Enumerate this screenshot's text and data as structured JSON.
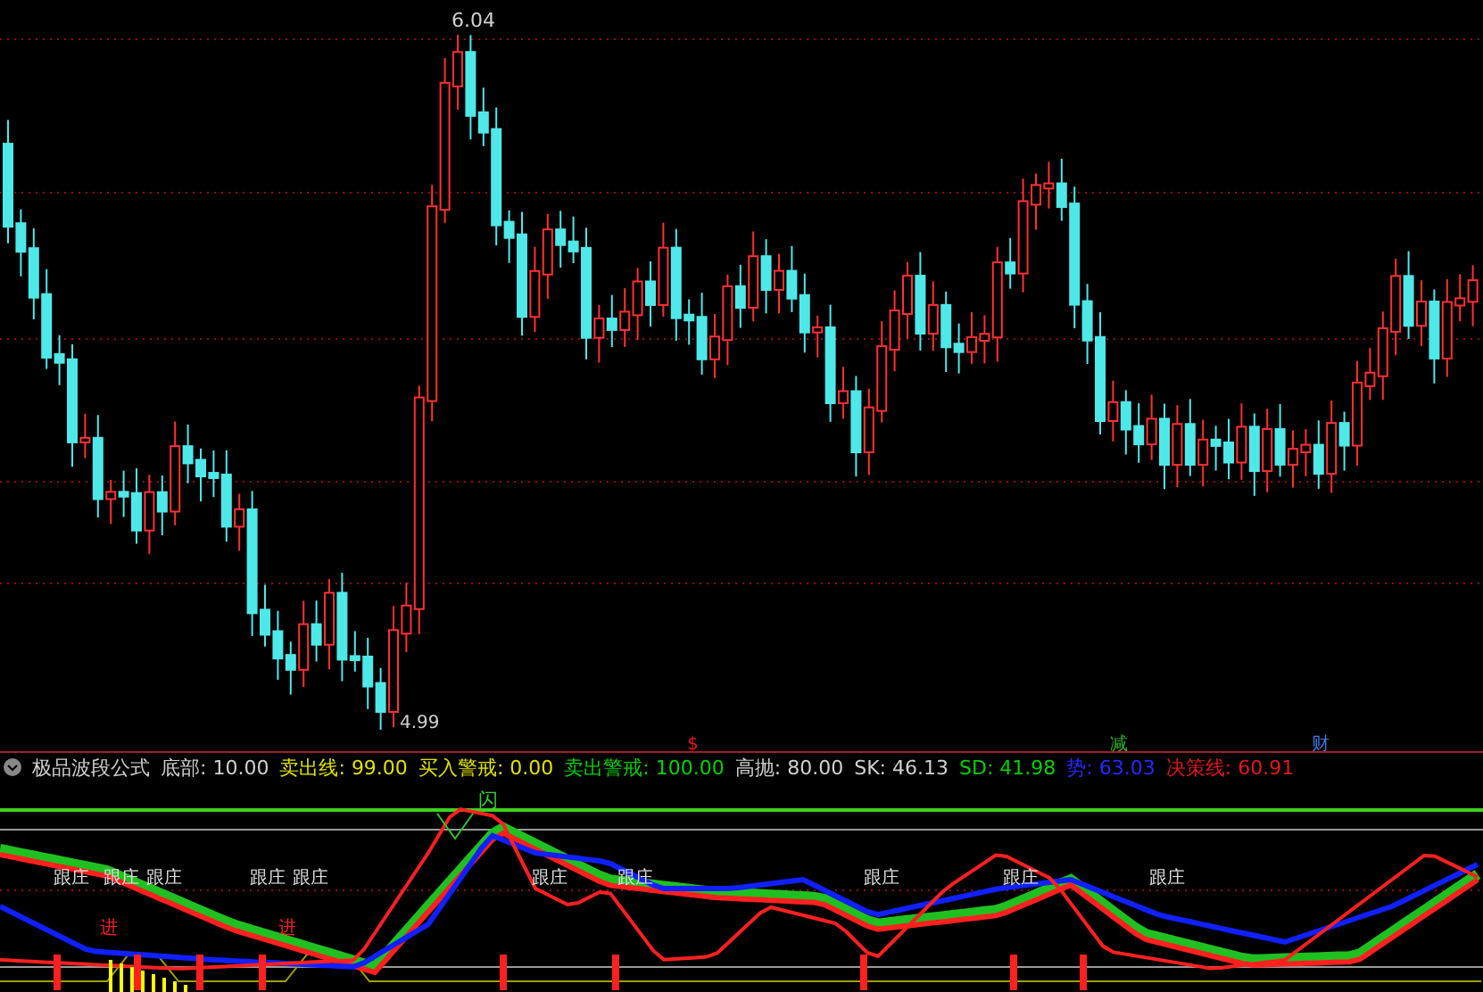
{
  "main_chart": {
    "high_label": "6.04",
    "low_label": "4.99",
    "signals": [
      {
        "text": "$",
        "color": "#e01818"
      },
      {
        "text": "减",
        "color": "#28b828"
      },
      {
        "text": "财",
        "color": "#3c78e0"
      }
    ]
  },
  "indicator": {
    "name": "极品波段公式",
    "params": [
      {
        "label": "底部:",
        "value": "10.00",
        "color": "#d0d0d0"
      },
      {
        "label": "卖出线:",
        "value": "99.00",
        "color": "#e0e000"
      },
      {
        "label": "买入警戒:",
        "value": "0.00",
        "color": "#e0e000"
      },
      {
        "label": "卖出警戒:",
        "value": "100.00",
        "color": "#00d000"
      },
      {
        "label": "高抛:",
        "value": "80.00",
        "color": "#d0d0d0"
      },
      {
        "label": "SK:",
        "value": "46.13",
        "color": "#d0d0d0"
      },
      {
        "label": "SD:",
        "value": "41.98",
        "color": "#00d000"
      },
      {
        "label": "势:",
        "value": "63.03",
        "color": "#2828ff"
      },
      {
        "label": "决策线:",
        "value": "60.91",
        "color": "#e01818"
      }
    ]
  },
  "panel": {
    "flash_label": "闪",
    "follow_labels": [
      "跟庄",
      "跟庄",
      "跟庄",
      "跟庄",
      "跟庄",
      "跟庄",
      "跟庄",
      "跟庄",
      "跟庄",
      "跟庄"
    ],
    "entry_labels": [
      "进",
      "进"
    ]
  }
}
